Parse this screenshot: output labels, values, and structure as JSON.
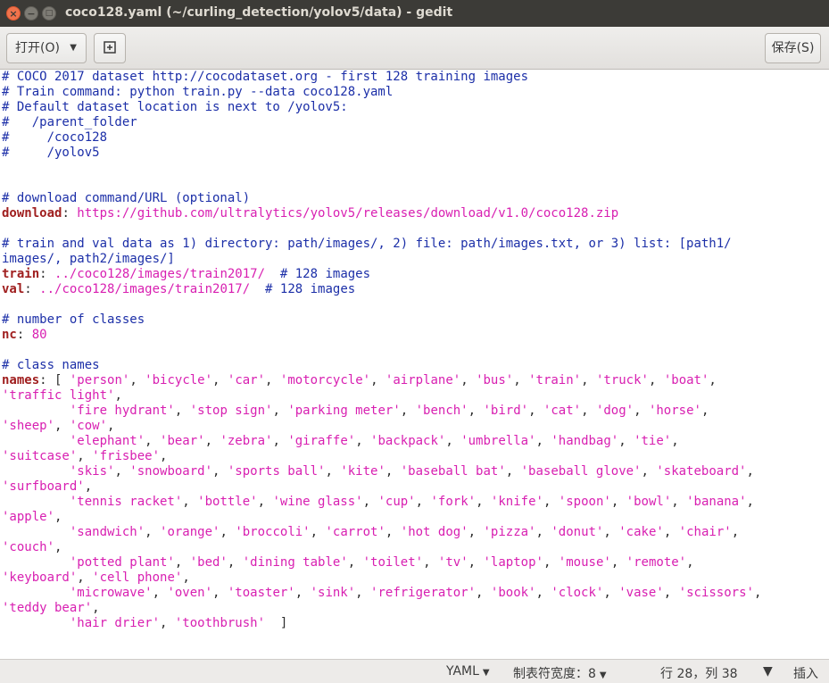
{
  "window": {
    "title": "coco128.yaml (~/curling_detection/yolov5/data) - gedit",
    "close_glyph": "×",
    "min_glyph": "−",
    "max_glyph": "□"
  },
  "toolbar": {
    "open_label": "打开(O)",
    "open_arrow": "▼",
    "new_glyph": "⊞",
    "save_label": "保存(S)"
  },
  "editor": {
    "lines": [
      [
        [
          "c",
          "# COCO 2017 dataset http://cocodataset.org - first 128 training images"
        ]
      ],
      [
        [
          "c",
          "# Train command: python train.py --data coco128.yaml"
        ]
      ],
      [
        [
          "c",
          "# Default dataset location is next to /yolov5:"
        ]
      ],
      [
        [
          "c",
          "#   /parent_folder"
        ]
      ],
      [
        [
          "c",
          "#     /coco128"
        ]
      ],
      [
        [
          "c",
          "#     /yolov5"
        ]
      ],
      [],
      [],
      [
        [
          "c",
          "# download command/URL (optional)"
        ]
      ],
      [
        [
          "k",
          "download"
        ],
        [
          "p",
          ": "
        ],
        [
          "s",
          "https://github.com/ultralytics/yolov5/releases/download/v1.0/coco128.zip"
        ]
      ],
      [],
      [
        [
          "c",
          "# train and val data as 1) directory: path/images/, 2) file: path/images.txt, or 3) list: [path1/"
        ]
      ],
      [
        [
          "c",
          "images/, path2/images/]"
        ]
      ],
      [
        [
          "k",
          "train"
        ],
        [
          "p",
          ": "
        ],
        [
          "s",
          "../coco128/images/train2017/"
        ],
        [
          "p",
          "  "
        ],
        [
          "c",
          "# 128 images"
        ]
      ],
      [
        [
          "k",
          "val"
        ],
        [
          "p",
          ": "
        ],
        [
          "s",
          "../coco128/images/train2017/"
        ],
        [
          "p",
          "  "
        ],
        [
          "c",
          "# 128 images"
        ]
      ],
      [],
      [
        [
          "c",
          "# number of classes"
        ]
      ],
      [
        [
          "k",
          "nc"
        ],
        [
          "p",
          ": "
        ],
        [
          "s",
          "80"
        ]
      ],
      [],
      [
        [
          "c",
          "# class names"
        ]
      ],
      [
        [
          "k",
          "names"
        ],
        [
          "p",
          ": [ "
        ],
        [
          "s",
          "'person'"
        ],
        [
          "p",
          ", "
        ],
        [
          "s",
          "'bicycle'"
        ],
        [
          "p",
          ", "
        ],
        [
          "s",
          "'car'"
        ],
        [
          "p",
          ", "
        ],
        [
          "s",
          "'motorcycle'"
        ],
        [
          "p",
          ", "
        ],
        [
          "s",
          "'airplane'"
        ],
        [
          "p",
          ", "
        ],
        [
          "s",
          "'bus'"
        ],
        [
          "p",
          ", "
        ],
        [
          "s",
          "'train'"
        ],
        [
          "p",
          ", "
        ],
        [
          "s",
          "'truck'"
        ],
        [
          "p",
          ", "
        ],
        [
          "s",
          "'boat'"
        ],
        [
          "p",
          ","
        ]
      ],
      [
        [
          "s",
          "'traffic light'"
        ],
        [
          "p",
          ","
        ]
      ],
      [
        [
          "p",
          "         "
        ],
        [
          "s",
          "'fire hydrant'"
        ],
        [
          "p",
          ", "
        ],
        [
          "s",
          "'stop sign'"
        ],
        [
          "p",
          ", "
        ],
        [
          "s",
          "'parking meter'"
        ],
        [
          "p",
          ", "
        ],
        [
          "s",
          "'bench'"
        ],
        [
          "p",
          ", "
        ],
        [
          "s",
          "'bird'"
        ],
        [
          "p",
          ", "
        ],
        [
          "s",
          "'cat'"
        ],
        [
          "p",
          ", "
        ],
        [
          "s",
          "'dog'"
        ],
        [
          "p",
          ", "
        ],
        [
          "s",
          "'horse'"
        ],
        [
          "p",
          ","
        ]
      ],
      [
        [
          "s",
          "'sheep'"
        ],
        [
          "p",
          ", "
        ],
        [
          "s",
          "'cow'"
        ],
        [
          "p",
          ","
        ]
      ],
      [
        [
          "p",
          "         "
        ],
        [
          "s",
          "'elephant'"
        ],
        [
          "p",
          ", "
        ],
        [
          "s",
          "'bear'"
        ],
        [
          "p",
          ", "
        ],
        [
          "s",
          "'zebra'"
        ],
        [
          "p",
          ", "
        ],
        [
          "s",
          "'giraffe'"
        ],
        [
          "p",
          ", "
        ],
        [
          "s",
          "'backpack'"
        ],
        [
          "p",
          ", "
        ],
        [
          "s",
          "'umbrella'"
        ],
        [
          "p",
          ", "
        ],
        [
          "s",
          "'handbag'"
        ],
        [
          "p",
          ", "
        ],
        [
          "s",
          "'tie'"
        ],
        [
          "p",
          ","
        ]
      ],
      [
        [
          "s",
          "'suitcase'"
        ],
        [
          "p",
          ", "
        ],
        [
          "s",
          "'frisbee'"
        ],
        [
          "p",
          ","
        ]
      ],
      [
        [
          "p",
          "         "
        ],
        [
          "s",
          "'skis'"
        ],
        [
          "p",
          ", "
        ],
        [
          "s",
          "'snowboard'"
        ],
        [
          "p",
          ", "
        ],
        [
          "s",
          "'sports ball'"
        ],
        [
          "p",
          ", "
        ],
        [
          "s",
          "'kite'"
        ],
        [
          "p",
          ", "
        ],
        [
          "s",
          "'baseball bat'"
        ],
        [
          "p",
          ", "
        ],
        [
          "s",
          "'baseball glove'"
        ],
        [
          "p",
          ", "
        ],
        [
          "s",
          "'skateboard'"
        ],
        [
          "p",
          ","
        ]
      ],
      [
        [
          "s",
          "'surfboard'"
        ],
        [
          "p",
          ","
        ]
      ],
      [
        [
          "p",
          "         "
        ],
        [
          "s",
          "'tennis racket'"
        ],
        [
          "p",
          ", "
        ],
        [
          "s",
          "'bottle'"
        ],
        [
          "p",
          ", "
        ],
        [
          "s",
          "'wine glass'"
        ],
        [
          "p",
          ", "
        ],
        [
          "s",
          "'cup'"
        ],
        [
          "p",
          ", "
        ],
        [
          "s",
          "'fork'"
        ],
        [
          "p",
          ", "
        ],
        [
          "s",
          "'knife'"
        ],
        [
          "p",
          ", "
        ],
        [
          "s",
          "'spoon'"
        ],
        [
          "p",
          ", "
        ],
        [
          "s",
          "'bowl'"
        ],
        [
          "p",
          ", "
        ],
        [
          "s",
          "'banana'"
        ],
        [
          "p",
          ","
        ]
      ],
      [
        [
          "s",
          "'apple'"
        ],
        [
          "p",
          ","
        ]
      ],
      [
        [
          "p",
          "         "
        ],
        [
          "s",
          "'sandwich'"
        ],
        [
          "p",
          ", "
        ],
        [
          "s",
          "'orange'"
        ],
        [
          "p",
          ", "
        ],
        [
          "s",
          "'broccoli'"
        ],
        [
          "p",
          ", "
        ],
        [
          "s",
          "'carrot'"
        ],
        [
          "p",
          ", "
        ],
        [
          "s",
          "'hot dog'"
        ],
        [
          "p",
          ", "
        ],
        [
          "s",
          "'pizza'"
        ],
        [
          "p",
          ", "
        ],
        [
          "s",
          "'donut'"
        ],
        [
          "p",
          ", "
        ],
        [
          "s",
          "'cake'"
        ],
        [
          "p",
          ", "
        ],
        [
          "s",
          "'chair'"
        ],
        [
          "p",
          ","
        ]
      ],
      [
        [
          "s",
          "'couch'"
        ],
        [
          "p",
          ","
        ]
      ],
      [
        [
          "p",
          "         "
        ],
        [
          "s",
          "'potted plant'"
        ],
        [
          "p",
          ", "
        ],
        [
          "s",
          "'bed'"
        ],
        [
          "p",
          ", "
        ],
        [
          "s",
          "'dining table'"
        ],
        [
          "p",
          ", "
        ],
        [
          "s",
          "'toilet'"
        ],
        [
          "p",
          ", "
        ],
        [
          "s",
          "'tv'"
        ],
        [
          "p",
          ", "
        ],
        [
          "s",
          "'laptop'"
        ],
        [
          "p",
          ", "
        ],
        [
          "s",
          "'mouse'"
        ],
        [
          "p",
          ", "
        ],
        [
          "s",
          "'remote'"
        ],
        [
          "p",
          ","
        ]
      ],
      [
        [
          "s",
          "'keyboard'"
        ],
        [
          "p",
          ", "
        ],
        [
          "s",
          "'cell phone'"
        ],
        [
          "p",
          ","
        ]
      ],
      [
        [
          "p",
          "         "
        ],
        [
          "s",
          "'microwave'"
        ],
        [
          "p",
          ", "
        ],
        [
          "s",
          "'oven'"
        ],
        [
          "p",
          ", "
        ],
        [
          "s",
          "'toaster'"
        ],
        [
          "p",
          ", "
        ],
        [
          "s",
          "'sink'"
        ],
        [
          "p",
          ", "
        ],
        [
          "s",
          "'refrigerator'"
        ],
        [
          "p",
          ", "
        ],
        [
          "s",
          "'book'"
        ],
        [
          "p",
          ", "
        ],
        [
          "s",
          "'clock'"
        ],
        [
          "p",
          ", "
        ],
        [
          "s",
          "'vase'"
        ],
        [
          "p",
          ", "
        ],
        [
          "s",
          "'scissors'"
        ],
        [
          "p",
          ","
        ]
      ],
      [
        [
          "s",
          "'teddy bear'"
        ],
        [
          "p",
          ","
        ]
      ],
      [
        [
          "p",
          "         "
        ],
        [
          "s",
          "'hair drier'"
        ],
        [
          "p",
          ", "
        ],
        [
          "s",
          "'toothbrush'"
        ],
        [
          "p",
          "  ]"
        ]
      ]
    ],
    "cursor_line": 37
  },
  "statusbar": {
    "language": "YAML",
    "tab_width_label": "制表符宽度：",
    "tab_width": "8",
    "position": "行 28，列 38",
    "mode": "插入",
    "dropdown_arrow": "▼"
  },
  "colors": {
    "comment": "#1c2fa8",
    "key": "#a02020",
    "string": "#d81fb1",
    "titlebar": "#3c3b37"
  }
}
